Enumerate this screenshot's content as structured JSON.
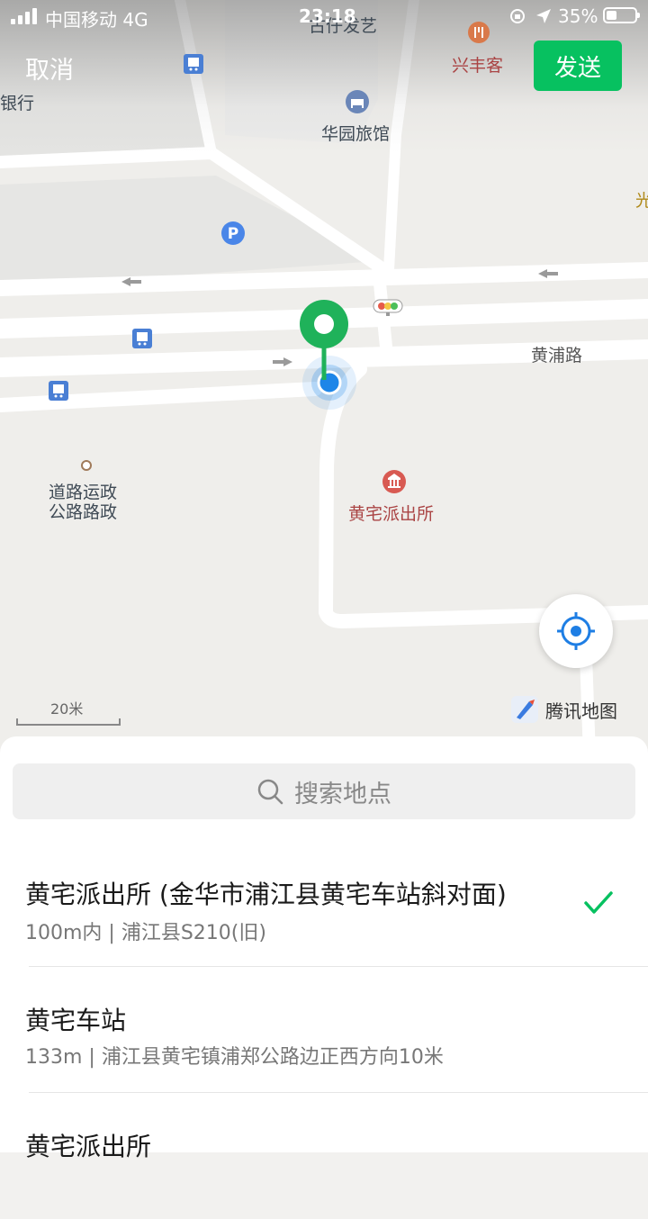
{
  "status_bar": {
    "carrier": "中国移动  4G",
    "time": "23:18",
    "battery_percent": "35%",
    "battery_level": 0.35
  },
  "header": {
    "cancel_label": "取消",
    "send_label": "发送"
  },
  "map": {
    "labels": {
      "bank": "银行",
      "hair_salon": "古仔发艺",
      "xingfengke": "兴丰客",
      "hotel": "华园旅馆",
      "guang": "光",
      "road_huangpu": "黄浦路",
      "transport": "道路运政\n公路路政",
      "police": "黄宅派出所"
    },
    "scale_text": "20米",
    "brand": "腾讯地图",
    "colors": {
      "pin": "#1fb25a",
      "location_dot": "#1e86e8",
      "accent": "#07c160"
    }
  },
  "search": {
    "placeholder": "搜索地点"
  },
  "results": [
    {
      "title": "黄宅派出所 (金华市浦江县黄宅车站斜对面)",
      "subtitle": "100m内 | 浦江县S210(旧)",
      "selected": true
    },
    {
      "title": "黄宅车站",
      "subtitle": "133m | 浦江县黄宅镇浦郑公路边正西方向10米",
      "selected": false
    },
    {
      "title": "黄宅派出所",
      "subtitle": "",
      "selected": false
    }
  ]
}
